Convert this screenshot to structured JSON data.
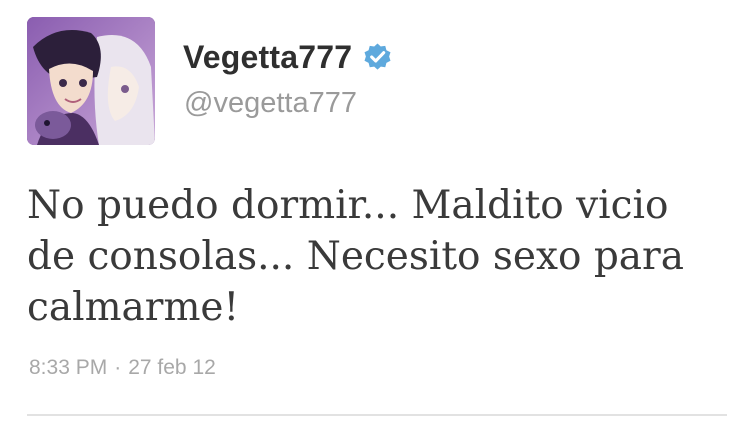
{
  "user": {
    "display_name": "Vegetta777",
    "handle": "@vegetta777",
    "verified": true,
    "avatar_icon": "anime-character-avatar"
  },
  "tweet": {
    "text": "No puedo dormir... Maldito vicio de consolas... Necesito sexo para calmarme!",
    "time": "8:33 PM",
    "separator": "·",
    "date": "27 feb 12"
  },
  "colors": {
    "verified": "#5ea9dd",
    "name": "#2f2f2f",
    "handle": "#9a9a9a",
    "text": "#3a3a3a",
    "meta": "#a8a8a8",
    "divider": "#e2e2e2"
  }
}
